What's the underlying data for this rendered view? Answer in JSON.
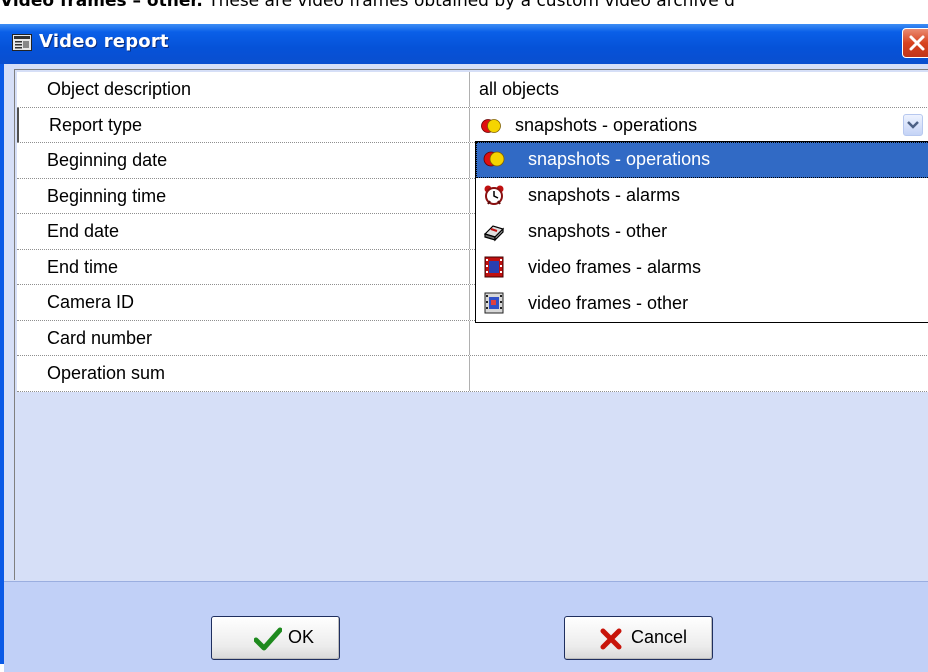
{
  "document": {
    "bold_lead": "Video frames – other.",
    "text": " These are video frames obtained  by a custom video archive d"
  },
  "window": {
    "title": "Video report",
    "title_icon": "report-window-icon",
    "close_icon": "close-icon"
  },
  "grid": {
    "rows": [
      {
        "label": "Object description",
        "value": "all objects"
      },
      {
        "label": "Report type",
        "value": "snapshots - operations"
      },
      {
        "label": "Beginning date",
        "value": ""
      },
      {
        "label": "Beginning time",
        "value": ""
      },
      {
        "label": "End date",
        "value": ""
      },
      {
        "label": "End time",
        "value": ""
      },
      {
        "label": "Camera ID",
        "value": ""
      },
      {
        "label": "Card number",
        "value": ""
      },
      {
        "label": "Operation sum",
        "value": ""
      }
    ]
  },
  "report_type_combo": {
    "selected": "snapshots - operations",
    "options": [
      {
        "label": "snapshots - operations",
        "icon": "operations-icon"
      },
      {
        "label": "snapshots - alarms",
        "icon": "alarm-clock-icon"
      },
      {
        "label": "snapshots - other",
        "icon": "eraser-icon"
      },
      {
        "label": "video frames - alarms",
        "icon": "film-alarm-icon"
      },
      {
        "label": "video frames - other",
        "icon": "film-other-icon"
      }
    ]
  },
  "buttons": {
    "ok": "OK",
    "cancel": "Cancel"
  },
  "colors": {
    "title_bar": "#0a5fe8",
    "client_bg": "#d6dff7",
    "highlight": "#316ac5",
    "close_button": "#d8431f"
  }
}
